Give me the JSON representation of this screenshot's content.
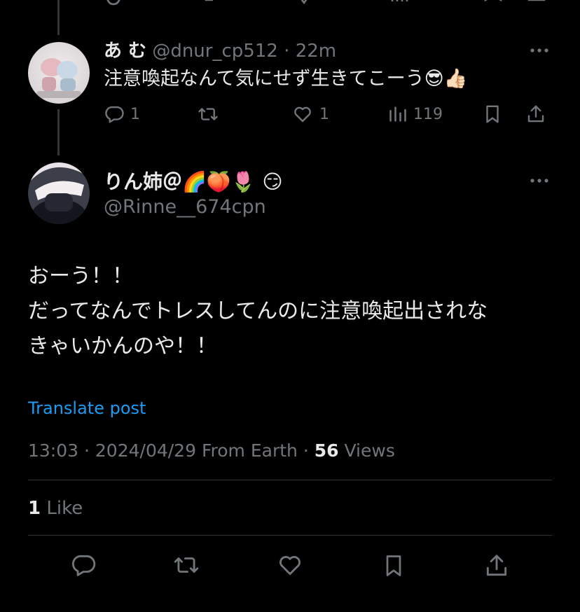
{
  "reply": {
    "display_name": "あ む",
    "handle": "@dnur_cp512",
    "separator": "·",
    "time": "22m",
    "text": "注意喚起なんて気にせず生きてこーう😎👍🏻",
    "replies_count": "1",
    "likes_count": "1",
    "views_count": "119"
  },
  "main_post": {
    "display_name": "りん姉＠🌈🍑🌷 😏",
    "handle": "@Rinne__674cpn",
    "lines": [
      "おーう！！",
      "だってなんでトレスしてんのに注意喚起出されな",
      "きゃいかんのや！！"
    ],
    "translate_label": "Translate post",
    "time": "13:03",
    "separator": "·",
    "date": "2024/04/29",
    "source": "From Earth",
    "views_count": "56",
    "views_label": "Views",
    "likes_count": "1",
    "likes_label": "Like"
  },
  "icons": {
    "more": "more-horizontal-icon",
    "reply": "reply-bubble-icon",
    "retweet": "retweet-icon",
    "like": "heart-icon",
    "views": "views-chart-icon",
    "bookmark": "bookmark-icon",
    "share": "share-icon"
  },
  "colors": {
    "background": "#000000",
    "primary_text": "#e7e9ea",
    "secondary_text": "#71767b",
    "link": "#1d9bf0",
    "divider": "#2f3336",
    "thread_line": "#333639"
  }
}
